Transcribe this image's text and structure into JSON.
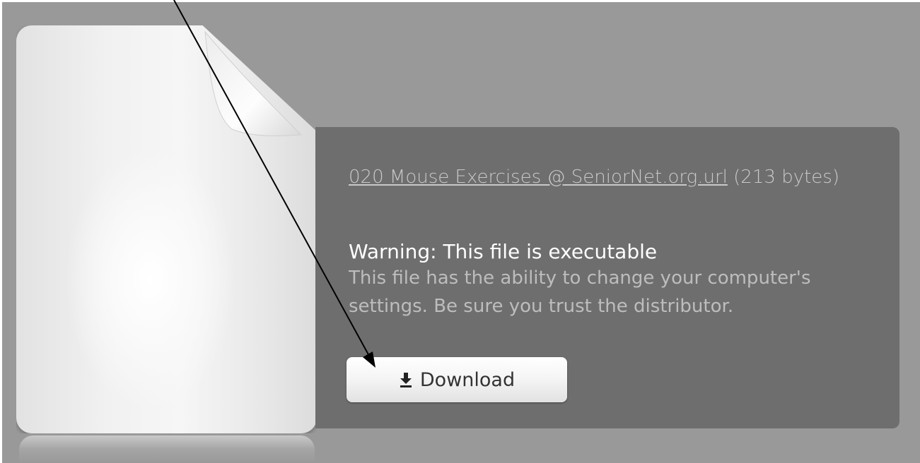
{
  "file": {
    "name": "020 Mouse Exercises @ SeniorNet.org.url",
    "size": "(213 bytes)"
  },
  "warning": {
    "title": "Warning: This file is executable",
    "body": "This file has the ability to change your computer's settings. Be sure you trust the distributor."
  },
  "download_button": {
    "label": "Download",
    "icon": "download-arrow-icon"
  },
  "colors": {
    "background": "#999999",
    "panel": "#6e6e6e",
    "annotation_arrow": "#000000"
  }
}
